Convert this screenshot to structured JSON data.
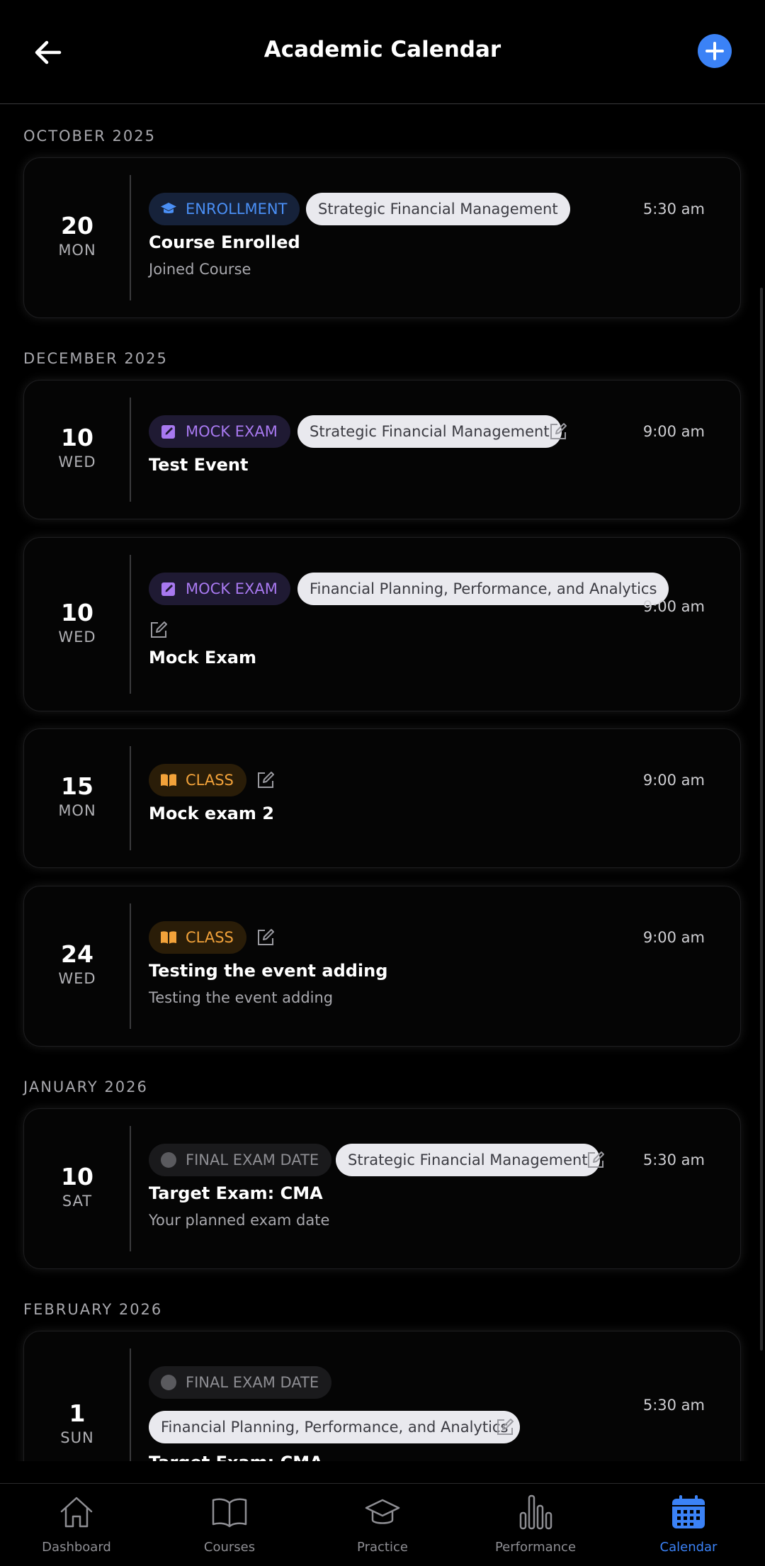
{
  "header": {
    "title": "Academic Calendar",
    "back_icon": "arrow-left-icon",
    "add_icon": "plus-icon"
  },
  "sections": [
    {
      "month": "OCTOBER 2025"
    },
    {
      "month": "DECEMBER 2025"
    },
    {
      "month": "JANUARY 2026"
    },
    {
      "month": "FEBRUARY 2026"
    }
  ],
  "events": [
    {
      "day": "20",
      "dow": "MON",
      "badge": "ENROLLMENT",
      "course": "Strategic Financial Management",
      "time": "5:30 am",
      "title": "Course Enrolled",
      "subtitle": "Joined Course"
    },
    {
      "day": "10",
      "dow": "WED",
      "badge": "MOCK EXAM",
      "course": "Strategic Financial Management",
      "time": "9:00 am",
      "title": "Test Event"
    },
    {
      "day": "10",
      "dow": "WED",
      "badge": "MOCK EXAM",
      "course": "Financial Planning, Performance, and Analytics",
      "time": "9:00 am",
      "title": "Mock Exam"
    },
    {
      "day": "15",
      "dow": "MON",
      "badge": "CLASS",
      "time": "9:00 am",
      "title": "Mock exam 2"
    },
    {
      "day": "24",
      "dow": "WED",
      "badge": "CLASS",
      "time": "9:00 am",
      "title": "Testing the event adding",
      "subtitle": "Testing the event adding"
    },
    {
      "day": "10",
      "dow": "SAT",
      "badge": "FINAL EXAM DATE",
      "course": "Strategic Financial Management",
      "time": "5:30 am",
      "title": "Target Exam: CMA",
      "subtitle": "Your planned exam date"
    },
    {
      "day": "1",
      "dow": "SUN",
      "badge": "FINAL EXAM DATE",
      "course": "Financial Planning, Performance, and Analytics",
      "time": "5:30 am",
      "title": "Target Exam: CMA"
    }
  ],
  "nav": [
    {
      "label": "Dashboard",
      "icon": "home-icon"
    },
    {
      "label": "Courses",
      "icon": "book-open-icon"
    },
    {
      "label": "Practice",
      "icon": "graduation-cap-icon"
    },
    {
      "label": "Performance",
      "icon": "bar-chart-icon"
    },
    {
      "label": "Calendar",
      "icon": "calendar-icon",
      "active": true
    }
  ],
  "colors": {
    "accent": "#3b82f6",
    "enrollment": "#4a8ff5",
    "mock_exam": "#a879f0",
    "class": "#f2a23a",
    "final_exam": "#8e8e93"
  }
}
